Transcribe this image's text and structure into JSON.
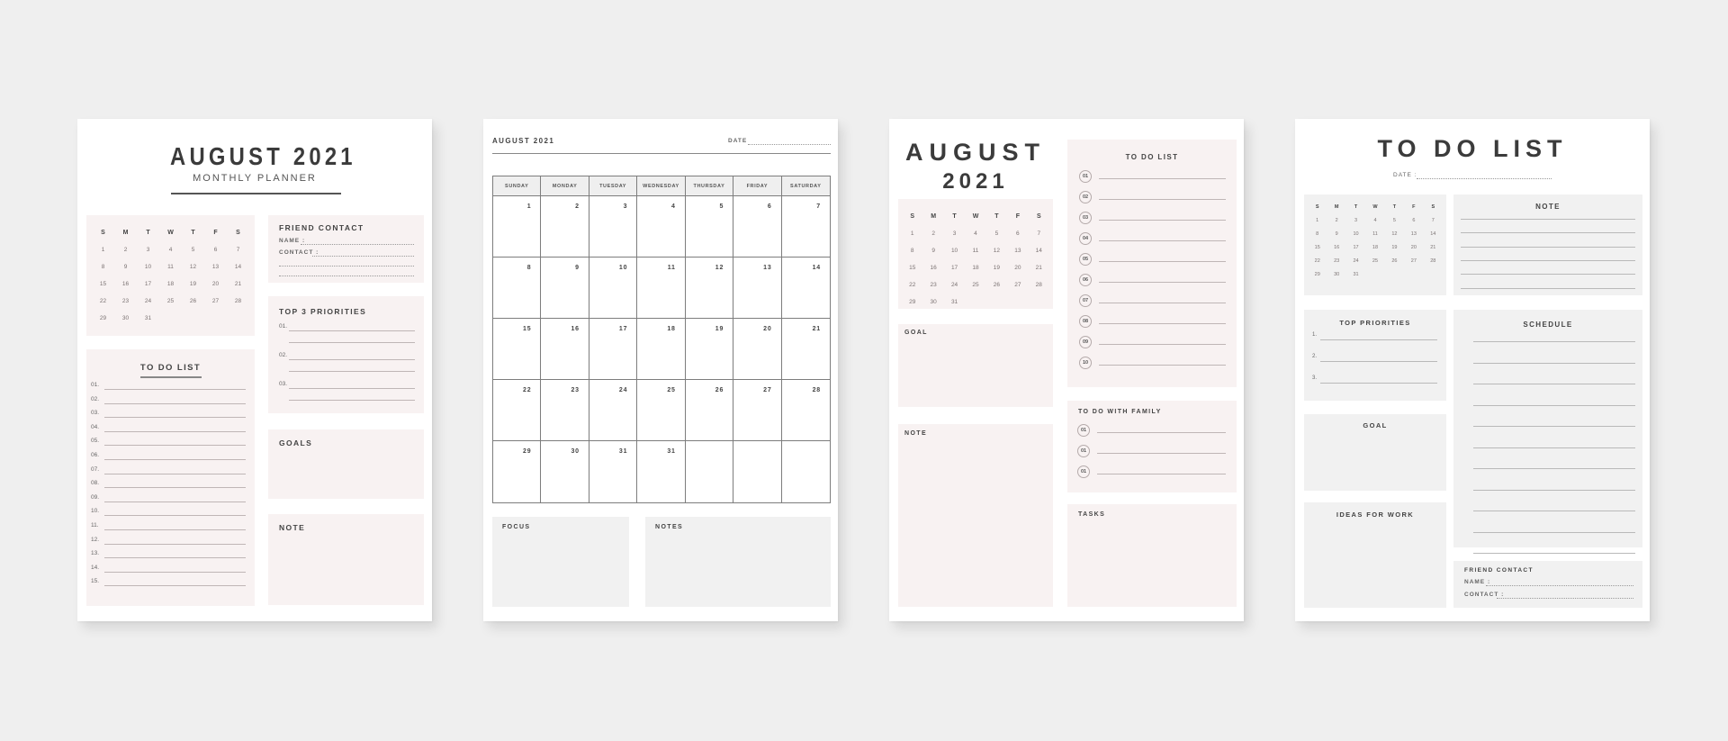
{
  "colors": {
    "background": "#efefef",
    "page": "#ffffff",
    "pink_box": "#f8f2f2",
    "grey_box": "#f1f1f1",
    "text": "#3a3a3a"
  },
  "calendar": {
    "weekday_initials": [
      "S",
      "M",
      "T",
      "W",
      "T",
      "F",
      "S"
    ],
    "days": [
      "1",
      "2",
      "3",
      "4",
      "5",
      "6",
      "7",
      "8",
      "9",
      "10",
      "11",
      "12",
      "13",
      "14",
      "15",
      "16",
      "17",
      "18",
      "19",
      "20",
      "21",
      "22",
      "23",
      "24",
      "25",
      "26",
      "27",
      "28",
      "29",
      "30",
      "31"
    ]
  },
  "page1": {
    "title": "AUGUST 2021",
    "subtitle": "MONTHLY PLANNER",
    "friend_contact": {
      "title": "FRIEND CONTACT",
      "name_label": "NAME :",
      "contact_label": "CONTACT :"
    },
    "priorities": {
      "title": "TOP 3 PRIORITIES",
      "items": [
        "01.",
        "02.",
        "03."
      ]
    },
    "todo": {
      "title": "TO DO LIST",
      "items": [
        "01.",
        "02.",
        "03.",
        "04.",
        "05.",
        "06.",
        "07.",
        "08.",
        "09.",
        "10.",
        "11.",
        "12.",
        "13.",
        "14.",
        "15."
      ]
    },
    "goals_title": "GOALS",
    "note_title": "NOTE"
  },
  "page2": {
    "title": "AUGUST 2021",
    "date_label": "DATE",
    "weekdays": [
      "SUNDAY",
      "MONDAY",
      "TUESDAY",
      "WEDNESDAY",
      "THURSDAY",
      "FRIDAY",
      "SATURDAY"
    ],
    "cells": [
      "1",
      "2",
      "3",
      "4",
      "5",
      "6",
      "7",
      "8",
      "9",
      "10",
      "11",
      "12",
      "13",
      "14",
      "15",
      "16",
      "17",
      "18",
      "19",
      "20",
      "21",
      "22",
      "23",
      "24",
      "25",
      "26",
      "27",
      "28",
      "29",
      "30",
      "31",
      "31",
      "",
      "",
      ""
    ],
    "focus_title": "FOCUS",
    "notes_title": "NOTES"
  },
  "page3": {
    "title_month": "AUGUST",
    "title_year": "2021",
    "todo": {
      "title": "TO DO LIST",
      "items": [
        "01",
        "02",
        "03",
        "04",
        "05",
        "06",
        "07",
        "08",
        "09",
        "10"
      ]
    },
    "family": {
      "title": "TO DO WITH FAMILY",
      "items": [
        "01",
        "01",
        "01"
      ]
    },
    "goal_title": "GOAL",
    "note_title": "NOTE",
    "tasks_title": "TASKS"
  },
  "page4": {
    "title": "TO DO LIST",
    "date_label": "DATE :",
    "note_title": "NOTE",
    "priorities": {
      "title": "TOP PRIORITIES",
      "items": [
        "1.",
        "2.",
        "3."
      ]
    },
    "schedule_title": "SCHEDULE",
    "goal_title": "GOAL",
    "ideas_title": "IDEAS FOR WORK",
    "friend_contact": {
      "title": "FRIEND CONTACT",
      "name_label": "NAME :",
      "contact_label": "CONTACT :"
    }
  }
}
